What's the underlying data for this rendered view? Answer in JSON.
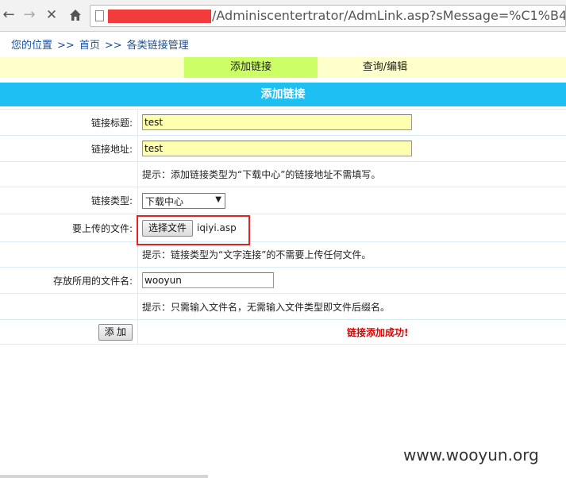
{
  "browser": {
    "url_visible": "/Adminiscentertrator/AdmLink.asp?sMessage=%C1%B4%"
  },
  "breadcrumb": {
    "items": [
      "您的位置",
      "首页",
      "各类链接管理"
    ],
    "separator": ">>"
  },
  "tabs": [
    {
      "label": "添加链接",
      "active": true
    },
    {
      "label": "查询/编辑",
      "active": false
    }
  ],
  "title": "添加链接",
  "form": {
    "link_title_label": "链接标题:",
    "link_title_value": "test",
    "link_url_label": "链接地址:",
    "link_url_value": "test",
    "hint_download": "提示：添加链接类型为“下载中心”的链接地址不需填写。",
    "link_type_label": "链接类型:",
    "link_type_value": "下载中心",
    "upload_label": "要上传的文件:",
    "choose_file_button": "选择文件",
    "chosen_file": "iqiyi.asp",
    "hint_text_link": "提示：链接类型为“文字连接”的不需要上传任何文件。",
    "save_name_label": "存放所用的文件名:",
    "save_name_value": "wooyun",
    "hint_filename": "提示：只需输入文件名，无需输入文件类型即文件后缀名。",
    "add_button": "添 加",
    "success_message": "链接添加成功!"
  },
  "watermark": "www.wooyun.org",
  "colors": {
    "tab_bar": "#ffffcc",
    "tab_active": "#ccff66",
    "title_bar": "#1ec0f3",
    "input_fill": "#ffffb0",
    "success": "#e00000",
    "highlight": "#e42222"
  }
}
